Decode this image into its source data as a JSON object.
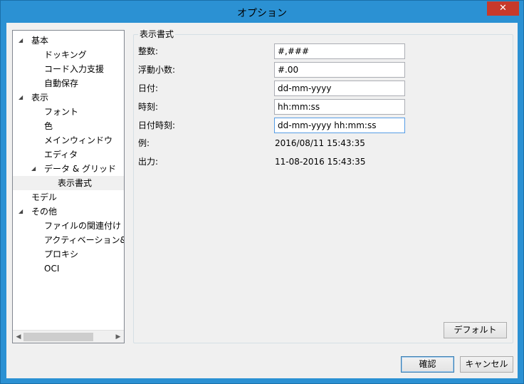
{
  "window": {
    "title": "オプション",
    "close_label": "✕"
  },
  "tree": {
    "items": [
      {
        "label": "基本",
        "expanded": true
      },
      {
        "label": "ドッキング"
      },
      {
        "label": "コード入力支援"
      },
      {
        "label": "自動保存"
      },
      {
        "label": "表示",
        "expanded": true
      },
      {
        "label": "フォント"
      },
      {
        "label": "色"
      },
      {
        "label": "メインウィンドウ"
      },
      {
        "label": "エディタ"
      },
      {
        "label": "データ & グリッド",
        "expanded": true
      },
      {
        "label": "表示書式",
        "selected": true
      },
      {
        "label": "モデル"
      },
      {
        "label": "その他",
        "expanded": true
      },
      {
        "label": "ファイルの関連付け"
      },
      {
        "label": "アクティベーション&アップ"
      },
      {
        "label": "プロキシ"
      },
      {
        "label": "OCI"
      }
    ],
    "scroll_left": "◀",
    "scroll_right": "▶",
    "expand_glyph": "◢"
  },
  "format": {
    "group_title": "表示書式",
    "integer_label": "整数:",
    "integer_value": "#,###",
    "float_label": "浮動小数:",
    "float_value": "#.00",
    "date_label": "日付:",
    "date_value": "dd-mm-yyyy",
    "time_label": "時刻:",
    "time_value": "hh:mm:ss",
    "datetime_label": "日付時刻:",
    "datetime_value": "dd-mm-yyyy hh:mm:ss",
    "example_label": "例:",
    "example_value": "2016/08/11 15:43:35",
    "output_label": "出力:",
    "output_value": "11-08-2016 15:43:35",
    "default_button": "デフォルト"
  },
  "footer": {
    "ok_button": "確認",
    "cancel_button": "キャンセル"
  },
  "colors": {
    "title_bar": "#2b91d3",
    "close_button": "#c7392b",
    "focus_border": "#569de5"
  }
}
